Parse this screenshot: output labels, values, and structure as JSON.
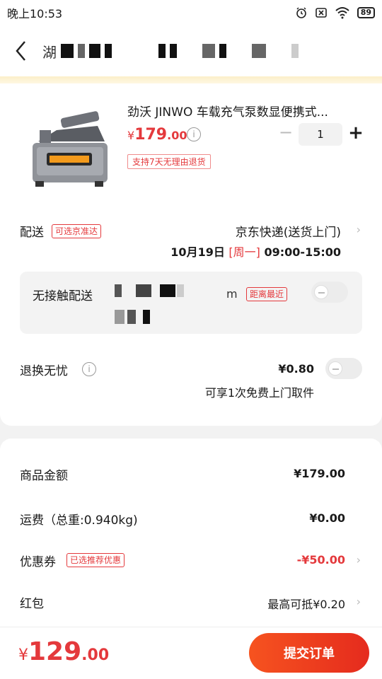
{
  "status_bar": {
    "time": "晚上10:53",
    "battery": "89"
  },
  "nav": {
    "title_visible": "湖"
  },
  "product": {
    "title": "劲沃 JINWO 车载充气泵数显便携式...",
    "price_currency": "¥",
    "price_int": "179",
    "price_dec": ".00",
    "info_icon": "i",
    "quantity": "1",
    "return_tag": "支持7天无理由退货"
  },
  "delivery": {
    "label": "配送",
    "tag": "可选京准达",
    "method": "京东快递(送货上门)",
    "date": "10月19日",
    "weekday": "[周一]",
    "time": "09:00-15:00"
  },
  "contactless": {
    "label": "无接触配送",
    "suffix": "m",
    "tag": "距离最近"
  },
  "return_service": {
    "label": "退换无忧",
    "info_icon": "i",
    "price": "¥0.80",
    "sub": "可享1次免费上门取件"
  },
  "summary": [
    {
      "label": "商品金额",
      "value": "¥179.00"
    },
    {
      "label": "运费（总重:0.940kg)",
      "value": "¥0.00"
    },
    {
      "label": "优惠券",
      "tag": "已选推荐优惠",
      "value": "-¥50.00"
    },
    {
      "label": "红包",
      "value": "最高可抵¥0.20"
    }
  ],
  "bottom": {
    "total_currency": "¥",
    "total_int": "129",
    "total_dec": ".00",
    "submit": "提交订单"
  },
  "colors": {
    "accent_red": "#e4393c",
    "button_gradient_start": "#f6531f"
  }
}
